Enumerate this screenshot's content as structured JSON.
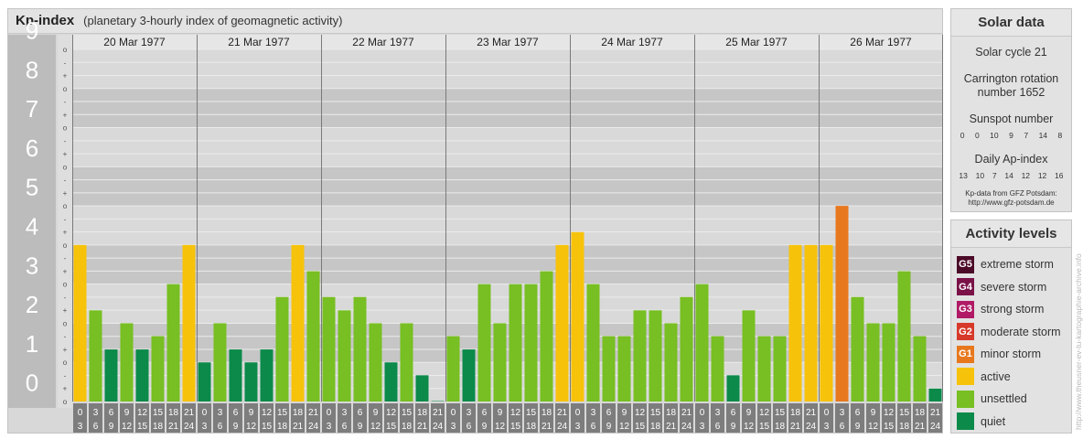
{
  "header": {
    "title": "Kp-index",
    "subtitle": "(planetary 3-hourly index of geomagnetic activity)"
  },
  "solar": {
    "title": "Solar data",
    "cycle": "Solar cycle 21",
    "carrington_line1": "Carrington rotation",
    "carrington_line2": "number 1652",
    "sunspot_label": "Sunspot number",
    "sunspot_values": [
      "0",
      "0",
      "10",
      "9",
      "7",
      "14",
      "8"
    ],
    "ap_label": "Daily Ap-index",
    "ap_values": [
      "13",
      "10",
      "7",
      "14",
      "12",
      "12",
      "16"
    ],
    "credit_line1": "Kp-data from GFZ Potsdam:",
    "credit_line2": "http://www.gfz-potsdam.de"
  },
  "activity": {
    "title": "Activity levels",
    "levels": [
      {
        "badge": "G5",
        "label": "extreme storm",
        "color": "#4b0a28"
      },
      {
        "badge": "G4",
        "label": "severe storm",
        "color": "#7a1248"
      },
      {
        "badge": "G3",
        "label": "strong storm",
        "color": "#b01a66"
      },
      {
        "badge": "G2",
        "label": "moderate storm",
        "color": "#d73a2a"
      },
      {
        "badge": "G1",
        "label": "minor storm",
        "color": "#e8781e"
      },
      {
        "badge": "",
        "label": "active",
        "color": "#f7c20a"
      },
      {
        "badge": "",
        "label": "unsettled",
        "color": "#77bf22"
      },
      {
        "badge": "",
        "label": "quiet",
        "color": "#0b8a4a"
      }
    ]
  },
  "watermark": "http://www.theusner-ev-tu-kartographie-archive.info",
  "chart_data": {
    "type": "bar",
    "title": "Kp-index",
    "ylabel": "",
    "ylim": [
      0,
      9
    ],
    "y_ticks": [
      "0",
      "1",
      "2",
      "3",
      "4",
      "5",
      "6",
      "7",
      "8",
      "9"
    ],
    "y_minor_labels": [
      "o",
      "+",
      "-"
    ],
    "days": [
      "20 Mar 1977",
      "21 Mar 1977",
      "22 Mar 1977",
      "23 Mar 1977",
      "24 Mar 1977",
      "25 Mar 1977",
      "26 Mar 1977"
    ],
    "interval_start": [
      "0",
      "3",
      "6",
      "9",
      "12",
      "15",
      "18",
      "21"
    ],
    "interval_end": [
      "3",
      "6",
      "9",
      "12",
      "15",
      "18",
      "21",
      "24"
    ],
    "levels_by_kp": {
      "quiet": "#0b8a4a",
      "unsettled": "#77bf22",
      "active": "#f7c20a",
      "minor_storm": "#e8781e"
    },
    "values": [
      [
        4.0,
        2.33,
        1.33,
        2.0,
        1.33,
        1.67,
        3.0,
        4.0
      ],
      [
        1.0,
        2.0,
        1.33,
        1.0,
        1.33,
        2.67,
        4.0,
        3.33
      ],
      [
        2.67,
        2.33,
        2.67,
        2.0,
        1.0,
        2.0,
        0.67,
        0.0
      ],
      [
        1.67,
        1.33,
        3.0,
        2.0,
        3.0,
        3.0,
        3.33,
        4.0
      ],
      [
        4.33,
        3.0,
        1.67,
        1.67,
        2.33,
        2.33,
        2.0,
        2.67
      ],
      [
        3.0,
        1.67,
        0.67,
        2.33,
        1.67,
        1.67,
        4.0,
        4.0
      ],
      [
        4.0,
        5.0,
        2.67,
        2.0,
        2.0,
        3.33,
        1.67,
        0.33
      ]
    ]
  }
}
